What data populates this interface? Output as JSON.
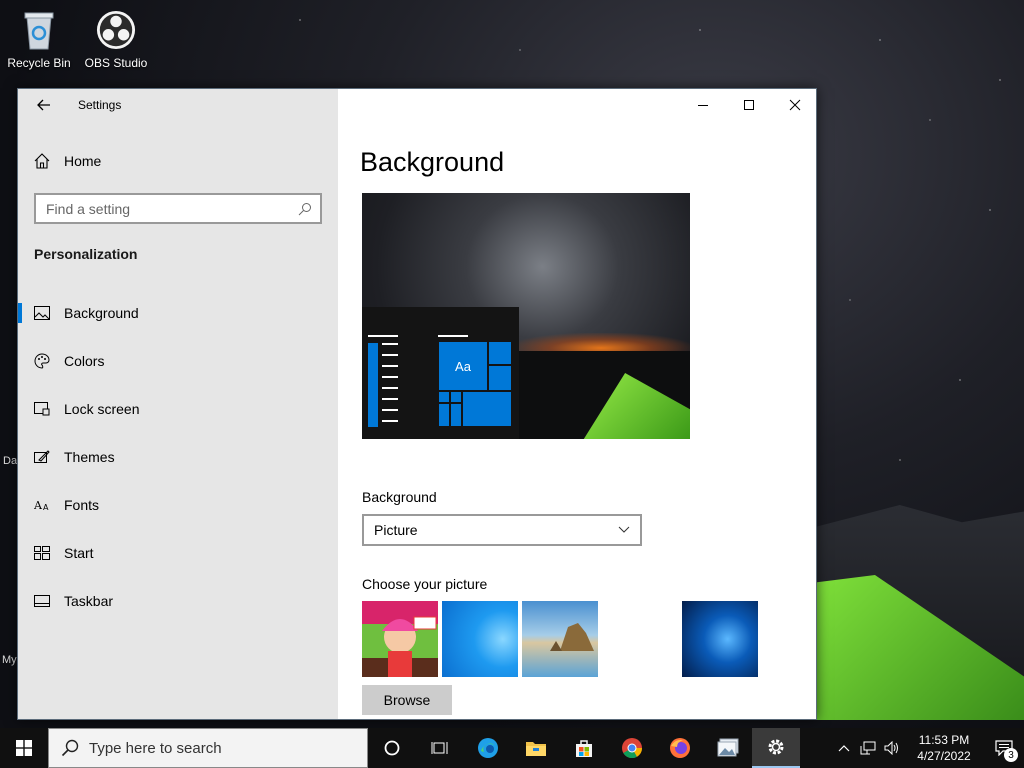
{
  "desktop": {
    "icons": [
      {
        "label": "Recycle Bin",
        "icon": "recycle-bin-icon"
      },
      {
        "label": "OBS Studio",
        "icon": "obs-studio-icon"
      }
    ],
    "edge_fragments": [
      "Da",
      "My"
    ]
  },
  "window": {
    "app_title": "Settings",
    "controls": {
      "minimize": "minimize-icon",
      "maximize": "maximize-icon",
      "close": "close-icon"
    }
  },
  "sidebar": {
    "home_label": "Home",
    "search_placeholder": "Find a setting",
    "section_title": "Personalization",
    "items": [
      {
        "label": "Background",
        "icon": "picture-icon",
        "active": true
      },
      {
        "label": "Colors",
        "icon": "palette-icon"
      },
      {
        "label": "Lock screen",
        "icon": "lock-screen-icon"
      },
      {
        "label": "Themes",
        "icon": "themes-icon"
      },
      {
        "label": "Fonts",
        "icon": "fonts-icon"
      },
      {
        "label": "Start",
        "icon": "start-icon"
      },
      {
        "label": "Taskbar",
        "icon": "taskbar-icon"
      }
    ]
  },
  "main": {
    "title": "Background",
    "preview": {
      "tile_text": "Aa"
    },
    "background_label": "Background",
    "background_value": "Picture",
    "choose_label": "Choose your picture",
    "browse_label": "Browse"
  },
  "taskbar": {
    "search_placeholder": "Type here to search",
    "pinned": [
      "cortana-icon",
      "task-view-icon",
      "edge-icon",
      "file-explorer-icon",
      "store-icon",
      "chrome-icon",
      "firefox-icon",
      "photos-icon",
      "settings-icon"
    ],
    "clock_time": "11:53 PM",
    "clock_date": "4/27/2022",
    "notification_count": "3"
  },
  "colors": {
    "accent": "#0078d7",
    "sidebar_bg": "#e6e6e6",
    "taskbar_bg": "#101010"
  }
}
